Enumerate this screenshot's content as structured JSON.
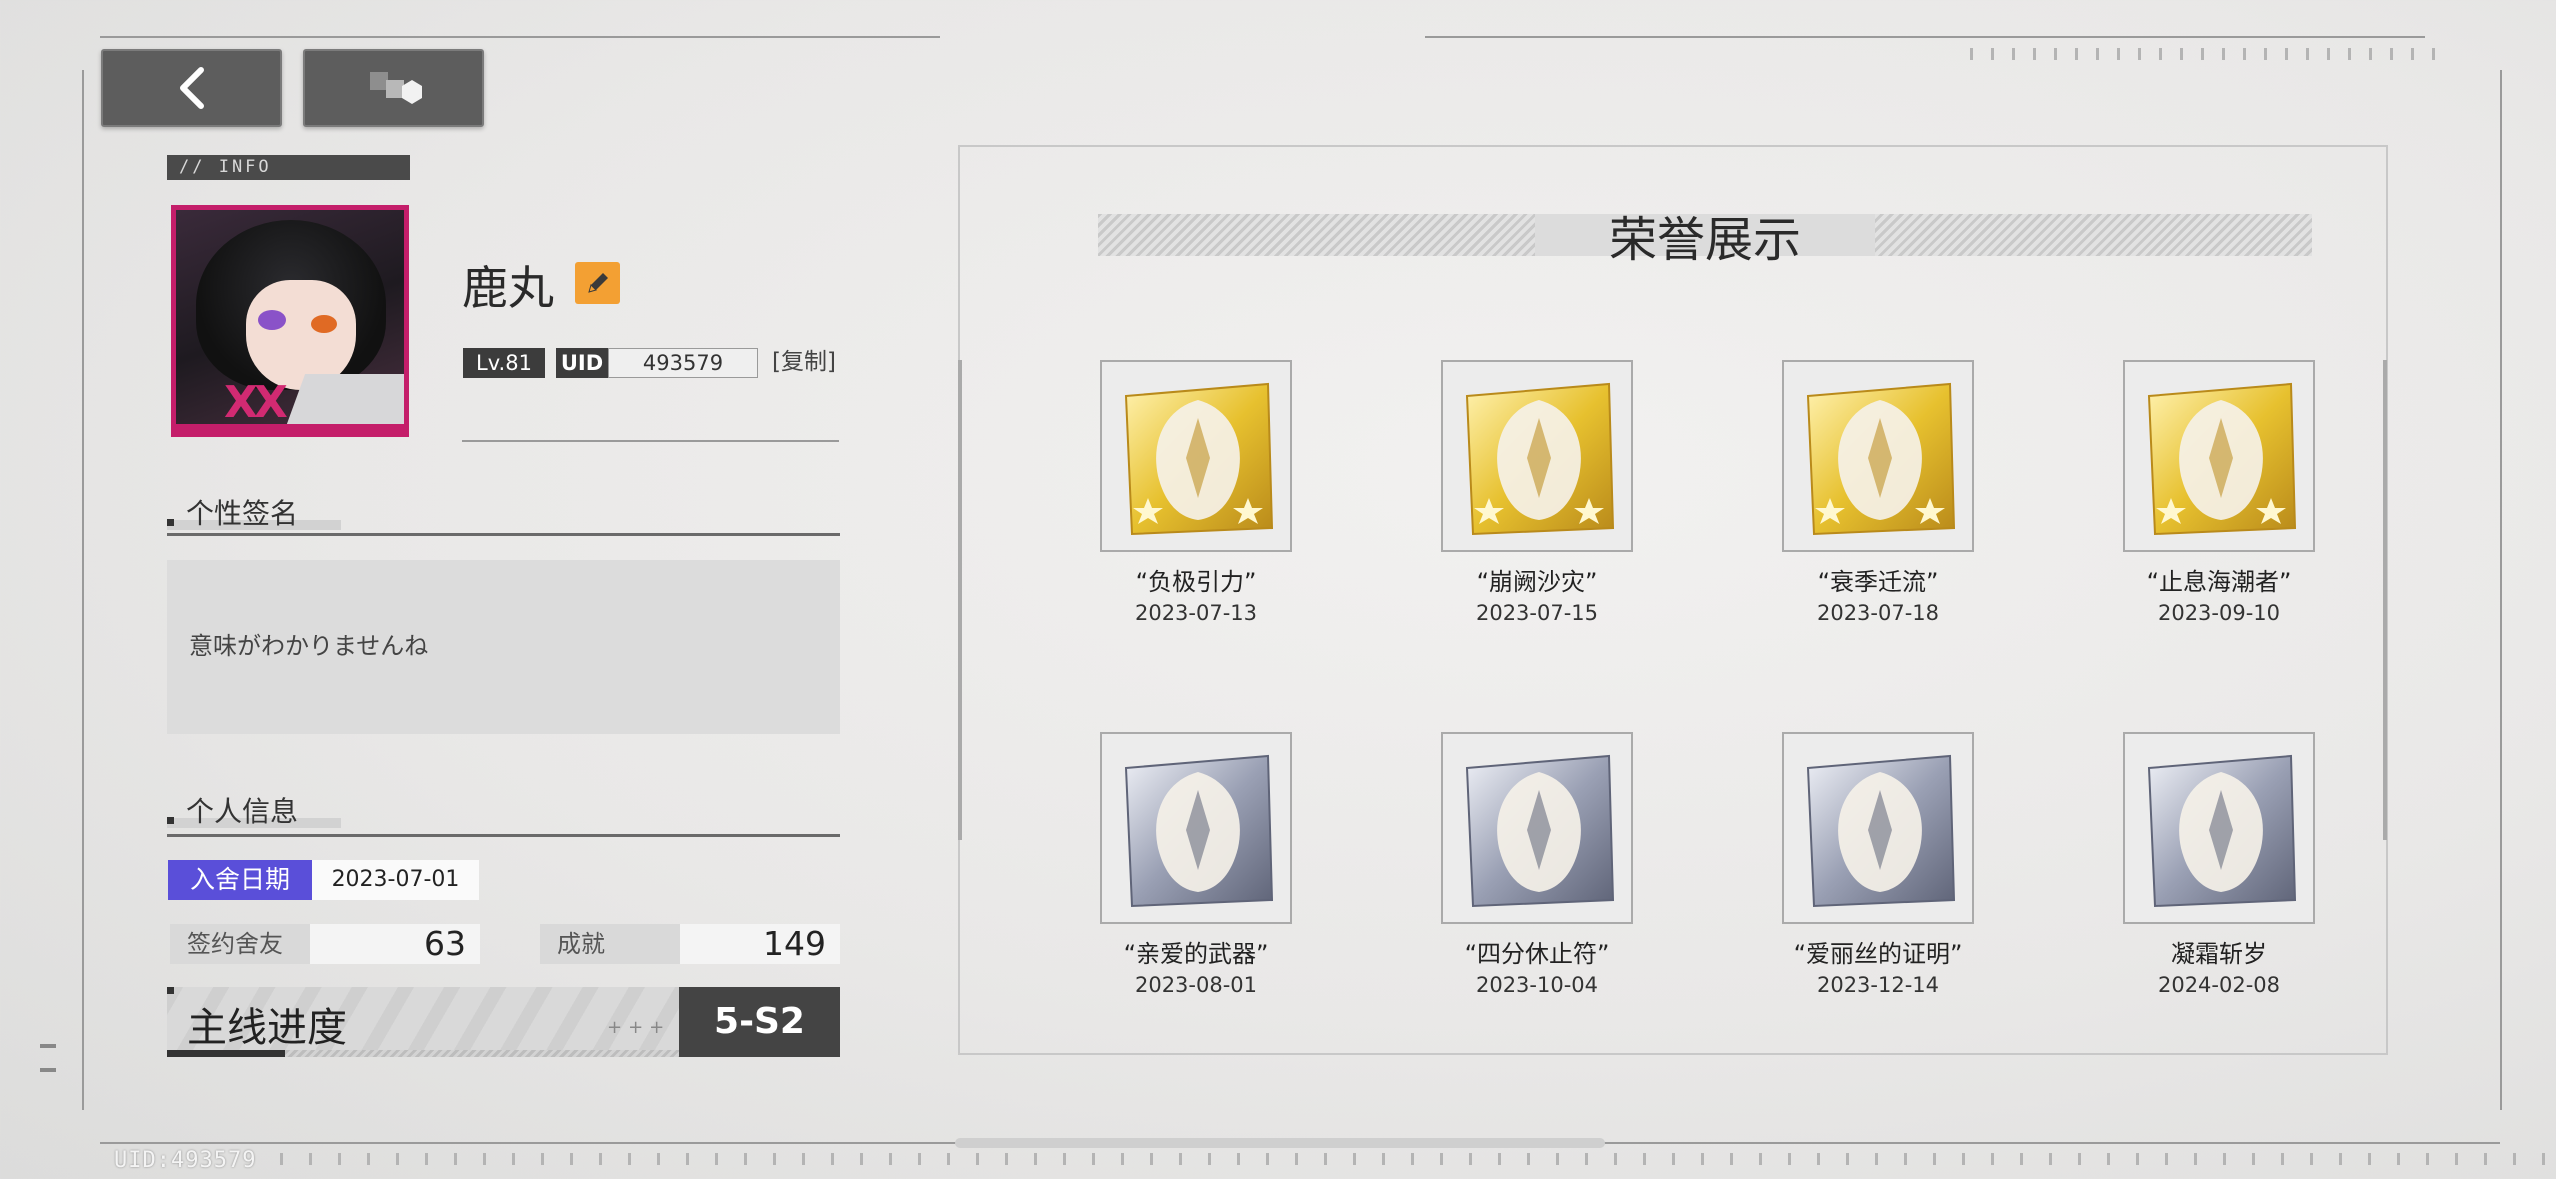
{
  "nav": {
    "info_tag": "// INFO"
  },
  "profile": {
    "name": "鹿丸",
    "level": "Lv.81",
    "uid_label": "UID",
    "uid": "493579",
    "copy_label": "[复制]"
  },
  "signature": {
    "heading": "个性签名",
    "text": "意味がわかりませんね"
  },
  "personal_info": {
    "heading": "个人信息",
    "join_label": "入舍日期",
    "join_date": "2023-07-01",
    "friends_label": "签约舍友",
    "friends_count": "63",
    "achievements_label": "成就",
    "achievements_count": "149",
    "progress_label": "主线进度",
    "progress_plus": "+++",
    "progress_value": "5-S2",
    "progress_fill_fraction": 0.23
  },
  "honors": {
    "title": "荣誉展示",
    "items": [
      {
        "name": "“负极引力”",
        "date": "2023-07-13",
        "tier": "gold",
        "icon": "hooded-figure-icon"
      },
      {
        "name": "“崩阙沙灾”",
        "date": "2023-07-15",
        "tier": "gold",
        "icon": "mech-robot-icon"
      },
      {
        "name": "“衰季迁流”",
        "date": "2023-07-18",
        "tier": "gold",
        "icon": "scythe-beast-icon"
      },
      {
        "name": "“止息海潮者”",
        "date": "2023-09-10",
        "tier": "gold",
        "icon": "sea-spirit-icon"
      },
      {
        "name": "“亲爱的武器”",
        "date": "2023-08-01",
        "tier": "silver",
        "icon": "blaster-gun-icon"
      },
      {
        "name": "“四分休止符”",
        "date": "2023-10-04",
        "tier": "silver",
        "icon": "flame-mask-icon"
      },
      {
        "name": "“爱丽丝的证明”",
        "date": "2023-12-14",
        "tier": "silver",
        "icon": "alice-silhouette-icon"
      },
      {
        "name": "凝霜斩岁",
        "date": "2024-02-08",
        "tier": "silver",
        "icon": "frost-dragon-icon"
      }
    ]
  },
  "footer": {
    "uid_text": "UID:493579"
  },
  "colors": {
    "accent_magenta": "#c41e6a",
    "edit_orange": "#f3a033",
    "join_purple": "#5a4fd9",
    "gold": "#e7c12f",
    "silver": "#9aa0b4"
  }
}
